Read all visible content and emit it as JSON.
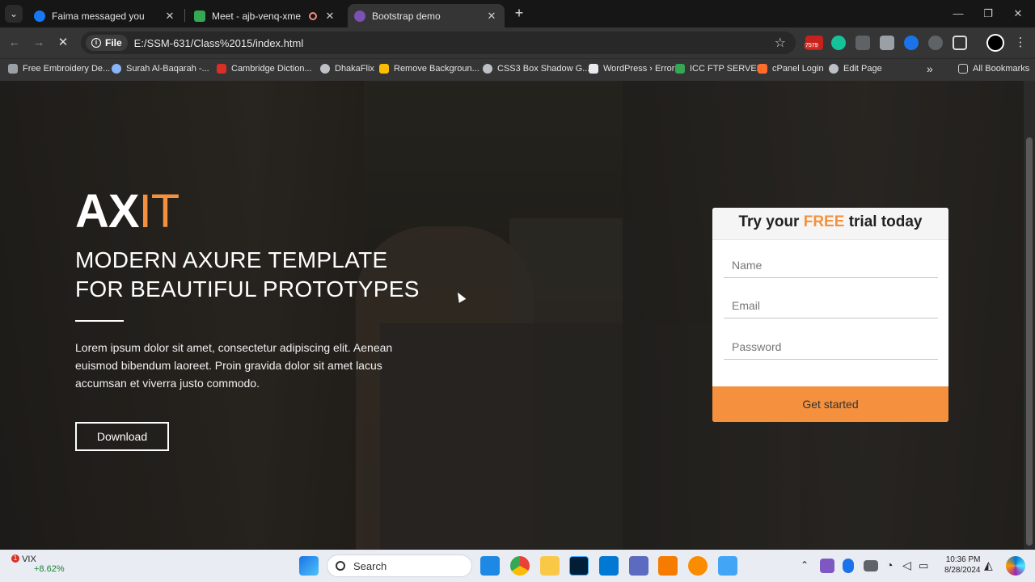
{
  "browser": {
    "tabs": [
      {
        "title": "Faima messaged you",
        "favicon_color": "#1877f2"
      },
      {
        "title": "Meet - ajb-venq-xme",
        "favicon_color": "#34a853"
      },
      {
        "title": "Bootstrap demo",
        "favicon_color": "#7952b3"
      }
    ],
    "tab_close_glyph": "✕",
    "new_tab_glyph": "+",
    "window_controls": [
      "—",
      "❐",
      "✕"
    ],
    "file_chip": "File",
    "url": "E:/SSM-631/Class%2015/index.html",
    "ext_badge": "7579",
    "bookmarks": [
      {
        "label": "Free Embroidery De...",
        "color": "#9aa0a6"
      },
      {
        "label": "Surah Al-Baqarah -...",
        "color": "#8ab4f8"
      },
      {
        "label": "Cambridge Diction...",
        "color": "#d93025"
      },
      {
        "label": "DhakaFlix",
        "color": "#bdc1c6"
      },
      {
        "label": "Remove Backgroun...",
        "color": "#fbbc04"
      },
      {
        "label": "CSS3 Box Shadow G...",
        "color": "#bdc1c6"
      },
      {
        "label": "WordPress › Error",
        "color": "#e8eaed"
      },
      {
        "label": "ICC FTP SERVER",
        "color": "#34a853"
      },
      {
        "label": "cPanel Login",
        "color": "#ff6c2c"
      },
      {
        "label": "Edit Page",
        "color": "#bdc1c6"
      }
    ],
    "bookmarks_overflow": "»",
    "all_bookmarks": "All Bookmarks"
  },
  "page": {
    "logo_main": "AX",
    "logo_accent": "IT",
    "headline_1": "MODERN AXURE TEMPLATE",
    "headline_2": "FOR BEAUTIFUL PROTOTYPES",
    "lead": "Lorem ipsum dolor sit amet, consectetur adipiscing elit. Aenean euismod bibendum laoreet. Proin gravida dolor sit amet lacus accumsan et viverra justo commodo.",
    "download_label": "Download",
    "accent_color": "#f5913e"
  },
  "form": {
    "title_before": "Try your ",
    "title_highlight": "FREE",
    "title_after": " trial today",
    "name_placeholder": "Name",
    "email_placeholder": "Email",
    "password_placeholder": "Password",
    "submit_label": "Get started"
  },
  "taskbar": {
    "widget_name": "VIX",
    "widget_change": "+8.62%",
    "widget_badge": "1",
    "search_label": "Search",
    "time": "10:36 PM",
    "date": "8/28/2024"
  }
}
